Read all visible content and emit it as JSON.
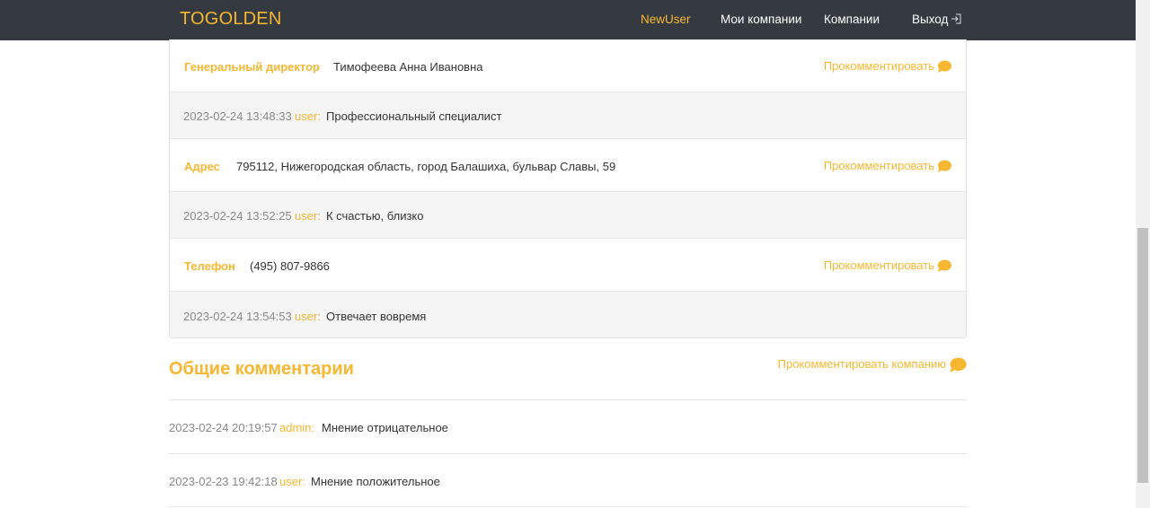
{
  "nav": {
    "brand": "TOGOLDEN",
    "user": "NewUser",
    "my_companies": "Мои компании",
    "companies": "Компании",
    "logout": "Выход"
  },
  "fields": [
    {
      "label": "Генеральный директор",
      "value": "Тимофеева Анна Ивановна",
      "action": "Прокомментировать",
      "comment": {
        "timestamp": "2023-02-24 13:48:33",
        "author": "user:",
        "text": "Профессиональный специалист"
      }
    },
    {
      "label": "Адрес",
      "value": "795112, Нижегородская область, город Балашиха, бульвар Славы, 59",
      "action": "Прокомментировать",
      "comment": {
        "timestamp": "2023-02-24 13:52:25",
        "author": "user:",
        "text": "К счастью, близко"
      }
    },
    {
      "label": "Телефон",
      "value": "(495) 807-9866",
      "action": "Прокомментировать",
      "comment": {
        "timestamp": "2023-02-24 13:54:53",
        "author": "user:",
        "text": "Отвечает вовремя"
      }
    }
  ],
  "general": {
    "title": "Общие комментарии",
    "action": "Прокомментировать компанию",
    "comments": [
      {
        "timestamp": "2023-02-24 20:19:57",
        "author": "admin:",
        "text": "Мнение отрицательное"
      },
      {
        "timestamp": "2023-02-23 19:42:18",
        "author": "user:",
        "text": "Мнение положительное"
      }
    ]
  },
  "colors": {
    "accent": "#f7b731",
    "navbar": "#343a40",
    "comment_bg": "#f5f5f5"
  }
}
